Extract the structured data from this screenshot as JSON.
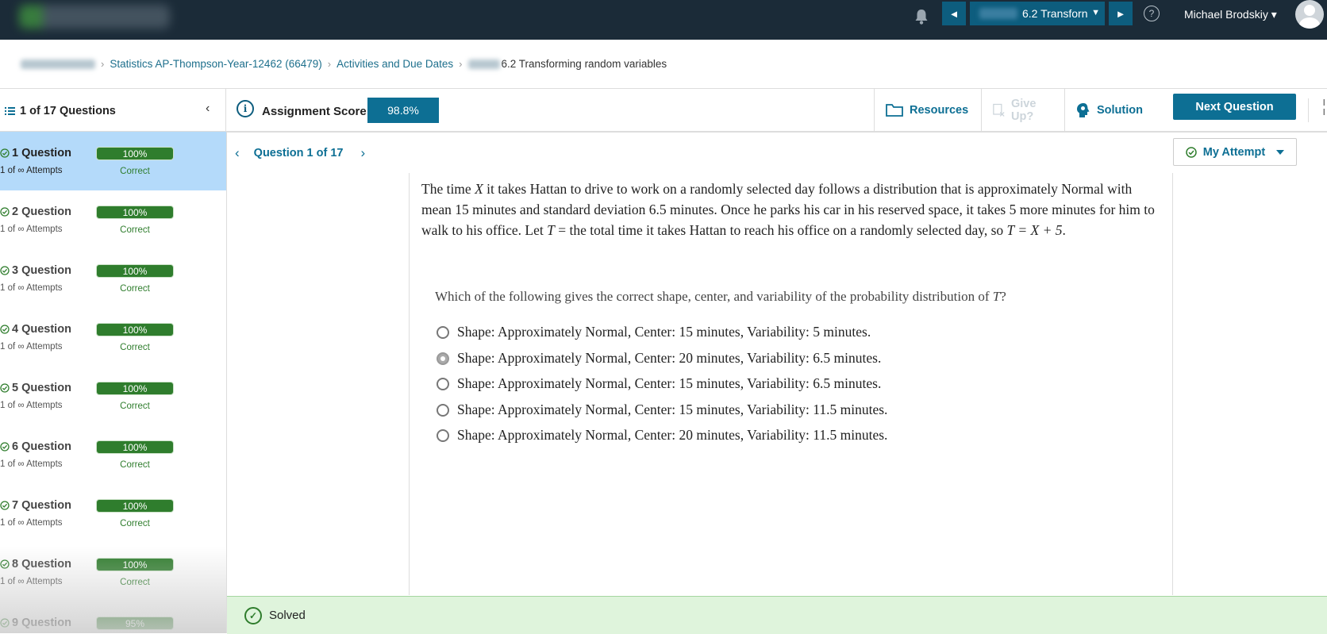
{
  "topbar": {
    "prev_symbol": "◄",
    "next_symbol": "►",
    "assignment_select": "6.2 Transforn",
    "select_arrow": "▼",
    "help_symbol": "?",
    "user_name": "Michael Brodskiy",
    "user_caret": "▾"
  },
  "breadcrumb": {
    "course": "Statistics AP-Thompson-Year-12462 (66479)",
    "activities": "Activities and Due Dates",
    "current": "6.2 Transforming random variables",
    "sep": "›"
  },
  "subbar": {
    "question_count": "1 of 17 Questions",
    "collapse_symbol": "‹",
    "info_symbol": "i",
    "score_label": "Assignment Score:",
    "score_value": "98.8%",
    "resources": "Resources",
    "give_up": "Give Up?",
    "solution": "Solution",
    "next_question": "Next Question",
    "edge_letters": "l\nl"
  },
  "sidebar": {
    "items": [
      {
        "title": "1 Question",
        "attempts": "1 of ∞ Attempts",
        "score": "100%",
        "status": "Correct"
      },
      {
        "title": "2 Question",
        "attempts": "1 of ∞ Attempts",
        "score": "100%",
        "status": "Correct"
      },
      {
        "title": "3 Question",
        "attempts": "1 of ∞ Attempts",
        "score": "100%",
        "status": "Correct"
      },
      {
        "title": "4 Question",
        "attempts": "1 of ∞ Attempts",
        "score": "100%",
        "status": "Correct"
      },
      {
        "title": "5 Question",
        "attempts": "1 of ∞ Attempts",
        "score": "100%",
        "status": "Correct"
      },
      {
        "title": "6 Question",
        "attempts": "1 of ∞ Attempts",
        "score": "100%",
        "status": "Correct"
      },
      {
        "title": "7 Question",
        "attempts": "1 of ∞ Attempts",
        "score": "100%",
        "status": "Correct"
      },
      {
        "title": "8 Question",
        "attempts": "1 of ∞ Attempts",
        "score": "100%",
        "status": "Correct"
      },
      {
        "title": "9 Question",
        "attempts": "",
        "score": "95%",
        "status": ""
      }
    ]
  },
  "question_nav": {
    "prev": "‹",
    "label": "Question 1 of 17",
    "next": "›",
    "my_attempt": "My Attempt"
  },
  "question": {
    "stem_part1": "The time ",
    "var_x": "X",
    "stem_part2": " it takes Hattan to drive to work on a randomly selected day follows a distribution that is approximately Normal with mean 15 minutes and standard deviation 6.5 minutes. Once he parks his car in his reserved space, it takes 5 more minutes for him to walk to his office. Let ",
    "var_t": "T",
    "stem_part3": " = the total time it takes Hattan to reach his office on a randomly selected day, so ",
    "equation": "T = X + 5",
    "stem_end": ".",
    "prompt_text": "Which of the following gives the correct shape, center, and variability of the probability distribution of ",
    "prompt_var": "T",
    "prompt_end": "?",
    "options": [
      "Shape: Approximately Normal, Center: 15 minutes, Variability: 5 minutes.",
      "Shape: Approximately Normal, Center: 20 minutes, Variability: 6.5 minutes.",
      "Shape: Approximately Normal, Center: 15 minutes, Variability: 6.5 minutes.",
      "Shape: Approximately Normal, Center: 15 minutes, Variability: 11.5 minutes.",
      "Shape: Approximately Normal, Center: 20 minutes, Variability: 11.5 minutes."
    ],
    "selected_option_index": 1
  },
  "footer": {
    "check_symbol": "✓",
    "solved": "Solved"
  },
  "colors": {
    "topbar": "#1b2b38",
    "accent": "#0d6f94",
    "correct_green": "#2f7d2d",
    "active_row": "#b4dafa",
    "solved_bg": "#dff4dc"
  }
}
